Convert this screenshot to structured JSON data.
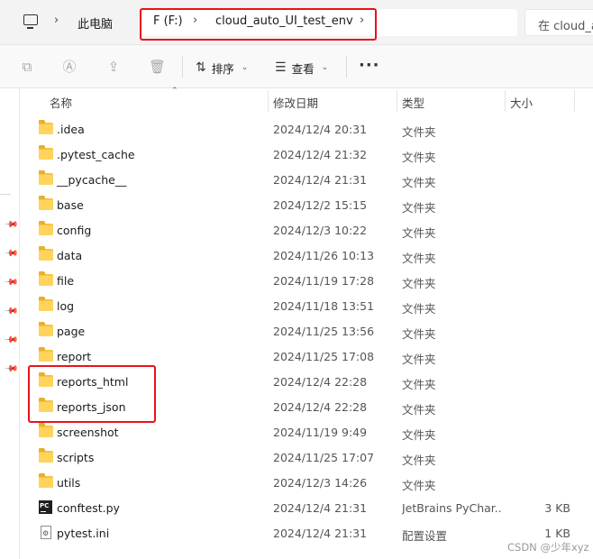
{
  "address_bar": {
    "computer_label": "此电脑",
    "drive_label": "F (F:)",
    "folder_label": "cloud_auto_UI_test_env",
    "search_placeholder": "在 cloud_a"
  },
  "toolbar": {
    "sort_label": "排序",
    "view_label": "查看",
    "more_label": "···",
    "icons": [
      "copy-icon",
      "rename-icon",
      "share-icon",
      "delete-icon"
    ]
  },
  "columns": {
    "name": "名称",
    "date": "修改日期",
    "type": "类型",
    "size": "大小"
  },
  "files": [
    {
      "name": ".idea",
      "date": "2024/12/4 20:31",
      "type": "文件夹",
      "size": "",
      "icon": "folder-icon"
    },
    {
      "name": ".pytest_cache",
      "date": "2024/12/4 21:32",
      "type": "文件夹",
      "size": "",
      "icon": "folder-icon"
    },
    {
      "name": "__pycache__",
      "date": "2024/12/4 21:31",
      "type": "文件夹",
      "size": "",
      "icon": "folder-icon"
    },
    {
      "name": "base",
      "date": "2024/12/2 15:15",
      "type": "文件夹",
      "size": "",
      "icon": "folder-icon"
    },
    {
      "name": "config",
      "date": "2024/12/3 10:22",
      "type": "文件夹",
      "size": "",
      "icon": "folder-icon"
    },
    {
      "name": "data",
      "date": "2024/11/26 10:13",
      "type": "文件夹",
      "size": "",
      "icon": "folder-icon"
    },
    {
      "name": "file",
      "date": "2024/11/19 17:28",
      "type": "文件夹",
      "size": "",
      "icon": "folder-icon"
    },
    {
      "name": "log",
      "date": "2024/11/18 13:51",
      "type": "文件夹",
      "size": "",
      "icon": "folder-icon"
    },
    {
      "name": "page",
      "date": "2024/11/25 13:56",
      "type": "文件夹",
      "size": "",
      "icon": "folder-icon"
    },
    {
      "name": "report",
      "date": "2024/11/25 17:08",
      "type": "文件夹",
      "size": "",
      "icon": "folder-icon"
    },
    {
      "name": "reports_html",
      "date": "2024/12/4 22:28",
      "type": "文件夹",
      "size": "",
      "icon": "folder-icon"
    },
    {
      "name": "reports_json",
      "date": "2024/12/4 22:28",
      "type": "文件夹",
      "size": "",
      "icon": "folder-icon"
    },
    {
      "name": "screenshot",
      "date": "2024/11/19 9:49",
      "type": "文件夹",
      "size": "",
      "icon": "folder-icon"
    },
    {
      "name": "scripts",
      "date": "2024/11/25 17:07",
      "type": "文件夹",
      "size": "",
      "icon": "folder-icon"
    },
    {
      "name": "utils",
      "date": "2024/12/3 14:26",
      "type": "文件夹",
      "size": "",
      "icon": "folder-icon"
    },
    {
      "name": "conftest.py",
      "date": "2024/12/4 21:31",
      "type": "JetBrains PyChar...",
      "size": "3 KB",
      "icon": "pycharm-file-icon"
    },
    {
      "name": "pytest.ini",
      "date": "2024/12/4 21:31",
      "type": "配置设置",
      "size": "1 KB",
      "icon": "ini-file-icon"
    }
  ],
  "watermark": "CSDN @少年xyz",
  "colors": {
    "highlight": "#e8131b",
    "folder": "#ffd35c"
  }
}
